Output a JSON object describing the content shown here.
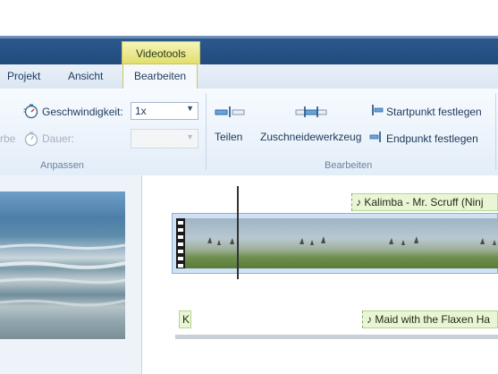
{
  "window": {
    "titlebar_color": "#244d80"
  },
  "context_tab": {
    "label": "Videotools",
    "color": "#e6e47a"
  },
  "tabs": [
    {
      "label": "Projekt",
      "active": false
    },
    {
      "label": "Ansicht",
      "active": false
    },
    {
      "label": "Bearbeiten",
      "active": true
    }
  ],
  "ribbon": {
    "anpassen": {
      "cut_off_label": "rbe",
      "speed_label": "Geschwindigkeit:",
      "speed_value": "1x",
      "duration_label": "Dauer:",
      "duration_value": "",
      "group_label": "Anpassen"
    },
    "bearbeiten": {
      "split_label": "Teilen",
      "trim_label": "Zuschneidewerkzeug",
      "start_label": "Startpunkt festlegen",
      "end_label": "Endpunkt festlegen",
      "group_label": "Bearbeiten"
    }
  },
  "storyboard": {
    "music_caption_1": "Kalimba - Mr. Scruff (Ninj",
    "caption_k": "K",
    "music_caption_2": "Maid with the Flaxen Ha",
    "music_icon": "music-note-icon"
  }
}
